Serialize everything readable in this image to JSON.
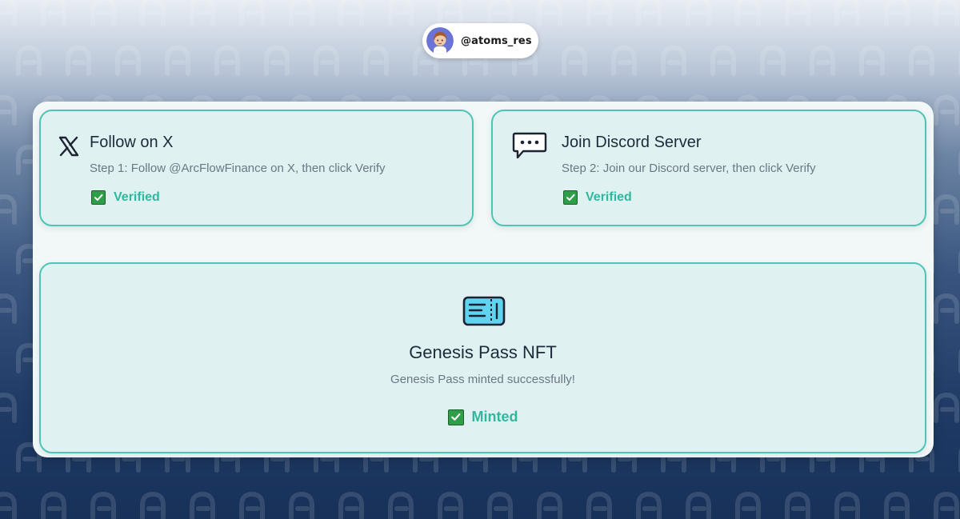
{
  "profile": {
    "handle": "@atoms_res",
    "avatar_icon": "cartoon-avatar"
  },
  "colors": {
    "accent": "#2fb89f",
    "card_border": "#4fc4b6",
    "card_bg": "#dff2f1",
    "check_green": "#2e9e48",
    "background_dark": "#1f3b66"
  },
  "tasks": [
    {
      "icon": "x-logo-icon",
      "title": "Follow on X",
      "description": "Step 1: Follow @ArcFlowFinance on X, then click Verify",
      "status": "Verified"
    },
    {
      "icon": "chat-bubble-icon",
      "title": "Join Discord Server",
      "description": "Step 2: Join our Discord server, then click Verify",
      "status": "Verified"
    }
  ],
  "nft": {
    "icon": "ticket-icon",
    "title": "Genesis Pass NFT",
    "description": "Genesis Pass minted successfully!",
    "status": "Minted"
  }
}
